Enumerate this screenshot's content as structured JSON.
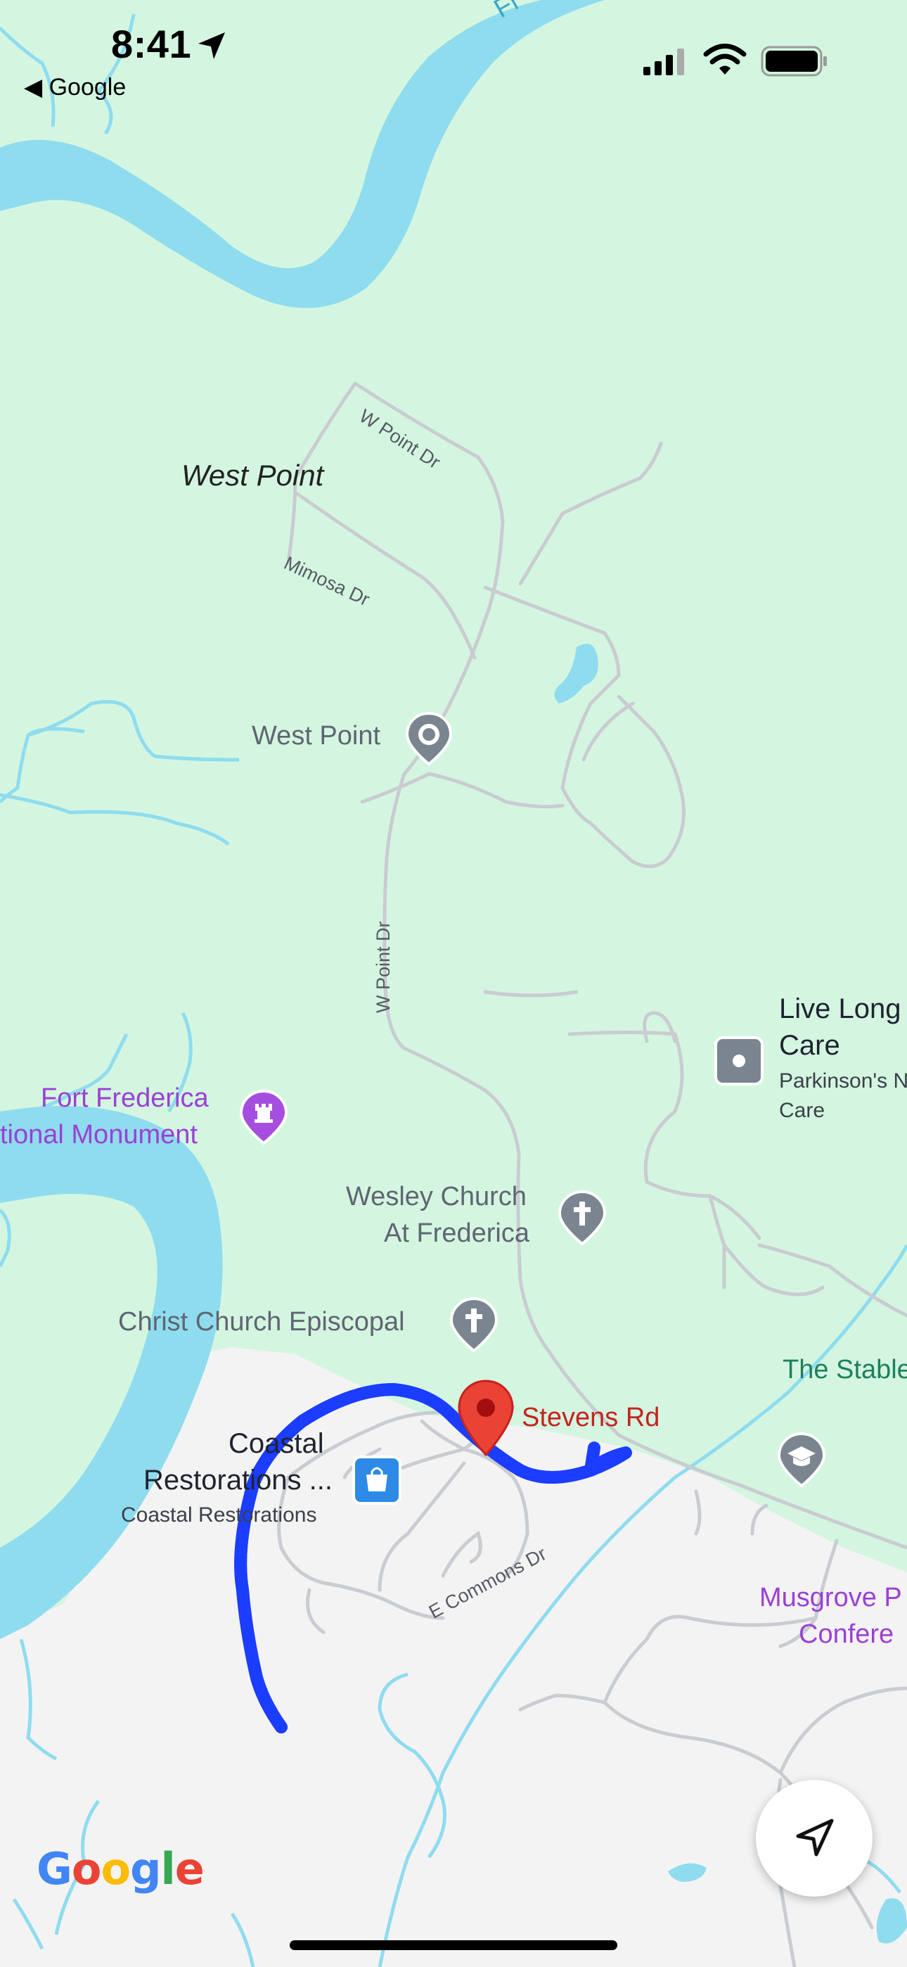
{
  "status_bar": {
    "time": "8:41",
    "back_app": "Google"
  },
  "colors": {
    "water": "#8fdcef",
    "land": "#d4f6e0",
    "urban": "#f4f3f4",
    "route": "#1a3dff",
    "pin": "#ea4335",
    "road": "#c9ccd1"
  },
  "map": {
    "place": "West Point",
    "roads": [
      "W Point Dr",
      "Mimosa Dr",
      "W Point Dr",
      "E Commons Dr"
    ],
    "pois": {
      "west_point": "West Point",
      "live_long_title": "Live Long",
      "live_long_title2": "Care",
      "live_long_sub": "Parkinson's N",
      "live_long_sub2": "Care",
      "fort_frederica_1": "Fort Frederica",
      "fort_frederica_2": "tional Monument",
      "wesley_1": "Wesley Church",
      "wesley_2": "At Frederica",
      "christ_church": "Christ Church Episcopal",
      "stevens_rd": "Stevens Rd",
      "stables": "The Stable",
      "coastal_1": "Coastal",
      "coastal_2": "Restorations ...",
      "coastal_sub": "Coastal Restorations",
      "musgrove_1": "Musgrove P",
      "musgrove_2": "Confere"
    },
    "partial_top_label": "Fr"
  },
  "icons": [
    "location-arrow-icon",
    "signal-icon",
    "wifi-icon",
    "battery-icon",
    "pin-icon",
    "monument-icon",
    "church-icon",
    "shopping-bag-icon",
    "school-icon",
    "red-pin-icon",
    "navigation-arrow-icon"
  ],
  "branding": {
    "logo_letters": [
      "G",
      "o",
      "o",
      "g",
      "l",
      "e"
    ]
  }
}
